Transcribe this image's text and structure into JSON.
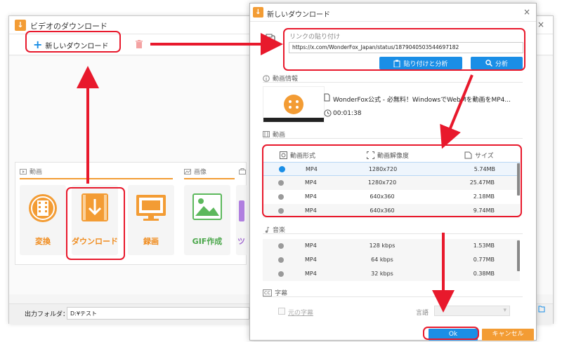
{
  "main_window": {
    "title": "ビデオのダウンロード",
    "close_icon": "×",
    "new_download_label": "新しいダウンロード",
    "sections": {
      "video": "動画",
      "image": "画像"
    },
    "tiles": [
      {
        "label": "変換",
        "icon": "convert-film-icon"
      },
      {
        "label": "ダウンロード",
        "icon": "download-icon"
      },
      {
        "label": "録画",
        "icon": "record-screen-icon"
      },
      {
        "label": "GIF作成",
        "icon": "gif-image-icon"
      },
      {
        "label": "ツ",
        "icon": "toolbox-icon"
      }
    ],
    "output_folder_label": "出力フォルダ：",
    "output_folder_value": "D:¥テスト"
  },
  "dialog": {
    "title": "新しいダウンロード",
    "close_icon": "×",
    "paste_section_label": "リンクの貼り付け",
    "url_value": "https://x.com/WonderFox_Japan/status/1879040503544697182",
    "paste_analyze_button": "貼り付けと分析",
    "analyze_button": "分析",
    "video_info_label": "動画情報",
    "video_title": "WonderFox公式 - 必無料！WindowsでWebMを動画をMP4...",
    "video_duration": "00:01:38",
    "video_section_label": "動画",
    "video_table_headers": {
      "format": "動画形式",
      "resolution": "動画解像度",
      "size": "サイズ"
    },
    "video_rows": [
      {
        "format": "MP4",
        "resolution": "1280x720",
        "size": "5.74MB",
        "selected": true
      },
      {
        "format": "MP4",
        "resolution": "1280x720",
        "size": "25.47MB",
        "selected": false
      },
      {
        "format": "MP4",
        "resolution": "640x360",
        "size": "2.18MB",
        "selected": false
      },
      {
        "format": "MP4",
        "resolution": "640x360",
        "size": "9.74MB",
        "selected": false
      }
    ],
    "audio_section_label": "音楽",
    "audio_rows": [
      {
        "format": "MP4",
        "bitrate": "128 kbps",
        "size": "1.53MB"
      },
      {
        "format": "MP4",
        "bitrate": "64 kbps",
        "size": "0.77MB"
      },
      {
        "format": "MP4",
        "bitrate": "32 kbps",
        "size": "0.38MB"
      }
    ],
    "subtitle_section_label": "字幕",
    "subtitle_icon_text": "CC",
    "original_subtitle_label": "元の字幕",
    "language_label": "言語",
    "ok_button": "Ok",
    "cancel_button": "キャンセル"
  },
  "colors": {
    "accent_blue": "#1a8ee6",
    "accent_orange": "#f39c34",
    "annotation_red": "#e8192c"
  }
}
